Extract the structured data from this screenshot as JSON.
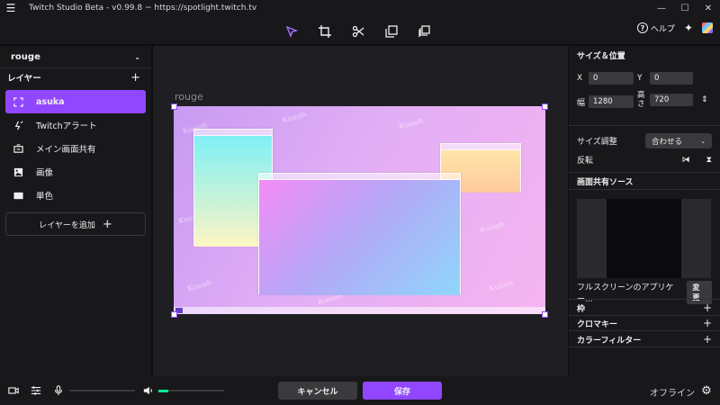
{
  "window": {
    "title": "Twitch Studio Beta - v0.99.8 ~ https://spotlight.twitch.tv",
    "minimize": "—",
    "maximize": "☐",
    "close": "✕"
  },
  "toolbar": {
    "tools": [
      "cursor-icon",
      "crop-icon",
      "scissors-icon",
      "duplicate-icon",
      "layers-stack-icon"
    ],
    "help_label": "ヘルプ",
    "help_glyph": "?",
    "accent": "#a970ff"
  },
  "left": {
    "scene_name": "rouge",
    "layers_heading": "レイヤー",
    "layers": [
      {
        "label": "asuka",
        "icon": "frame-icon",
        "active": true
      },
      {
        "label": "Twitchアラート",
        "icon": "alert-icon",
        "active": false
      },
      {
        "label": "メイン画面共有",
        "icon": "screen-share-icon",
        "active": false
      },
      {
        "label": "画像",
        "icon": "image-icon",
        "active": false
      },
      {
        "label": "単色",
        "icon": "color-icon",
        "active": false
      }
    ],
    "add_layer_label": "レイヤーを追加"
  },
  "canvas": {
    "scene_label": "rouge",
    "watermark": "Kusoh"
  },
  "right": {
    "size_pos_title": "サイズ＆位置",
    "x_label": "X",
    "x_value": "0",
    "y_label": "Y",
    "y_value": "0",
    "w_label": "幅",
    "w_value": "1280",
    "h_label": "高さ",
    "h_value": "720",
    "size_adjust_label": "サイズ調整",
    "size_adjust_value": "合わせる",
    "flip_label": "反転",
    "screen_source_title": "画面共有ソース",
    "source_name": "フルスクリーンのアプリケー...",
    "change_label": "変更",
    "frame_title": "枠",
    "chroma_title": "クロマキー",
    "filter_title": "カラーフィルター"
  },
  "bottom": {
    "cancel_label": "キャンセル",
    "save_label": "保存",
    "status": "オフライン",
    "mic_level": 0,
    "desktop_level": 0.15
  }
}
